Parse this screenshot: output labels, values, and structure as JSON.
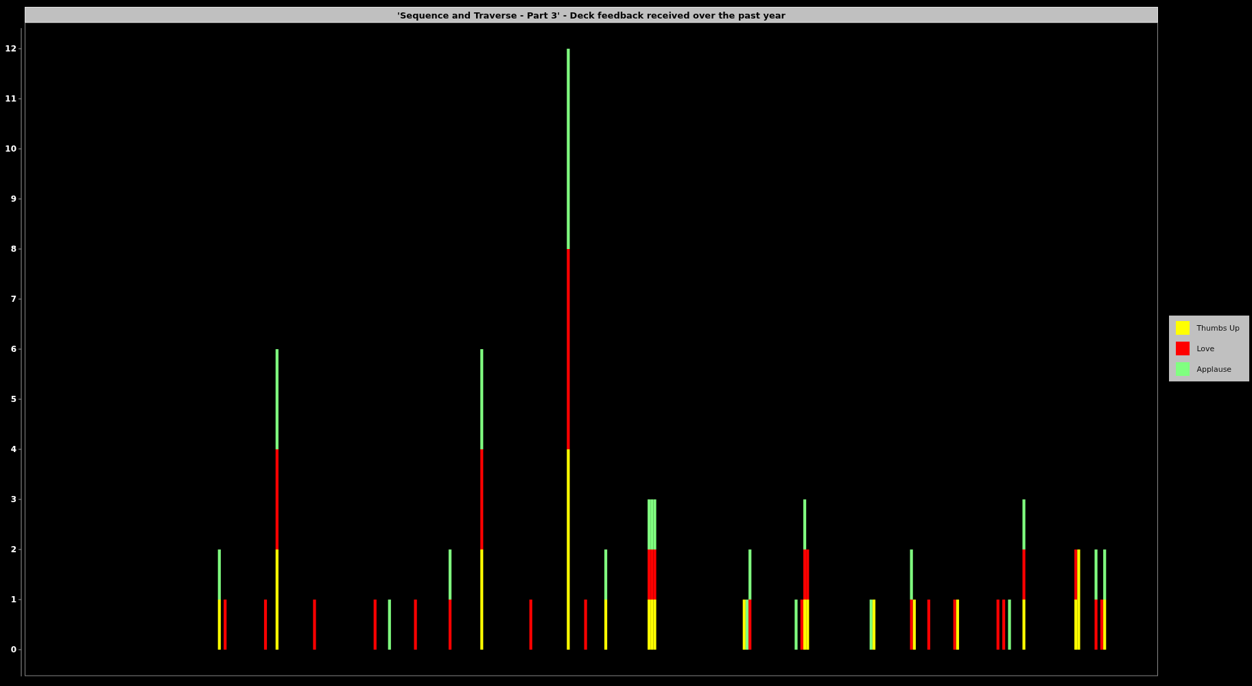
{
  "chart": {
    "title": "'Sequence and Traverse - Part 3' - Deck feedback received over the past year",
    "y_axis": {
      "ticks": [
        "12",
        "11",
        "10",
        "9",
        "8",
        "7",
        "6",
        "5",
        "4",
        "3",
        "2",
        "1",
        "0"
      ]
    },
    "legend": [
      {
        "label": "Thumbs Up",
        "color": "#ffff00"
      },
      {
        "label": "Love",
        "color": "#ff0000"
      },
      {
        "label": "Applause",
        "color": "#80ff80"
      }
    ]
  }
}
